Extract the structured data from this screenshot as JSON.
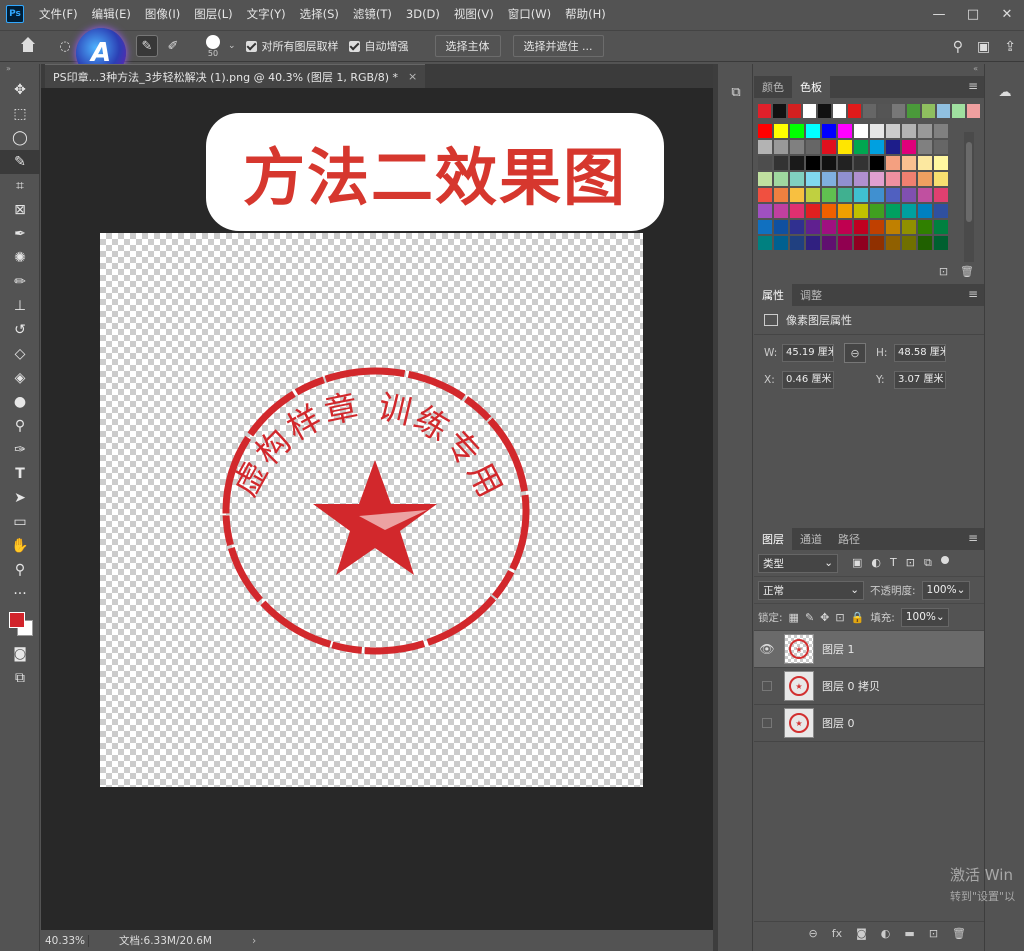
{
  "menubar": {
    "logo": "Ps",
    "items": [
      "文件(F)",
      "编辑(E)",
      "图像(I)",
      "图层(L)",
      "文字(Y)",
      "选择(S)",
      "滤镜(T)",
      "3D(D)",
      "视图(V)",
      "窗口(W)",
      "帮助(H)"
    ],
    "win_min": "—",
    "win_max": "□",
    "win_close": "✕"
  },
  "options": {
    "brush_size": "50",
    "sample_all_label": "对所有图层取样",
    "auto_enhance_label": "自动增强",
    "select_subject": "选择主体",
    "select_mask": "选择并遮住 ..."
  },
  "badge": {
    "letter": "A"
  },
  "document": {
    "tab_title": "PS印章...3种方法_3步轻松解决 (1).png @ 40.3% (图层 1, RGB/8) *",
    "tab_close": "×",
    "headline": "方法二效果图",
    "seal_text": "虚构样章 训练专用"
  },
  "status": {
    "zoom": "40.33%",
    "doc_info": "文档:6.33M/20.6M",
    "arrow": "›"
  },
  "colors_panel": {
    "tab_color": "颜色",
    "tab_swatches": "色板",
    "recent": [
      "#e0202a",
      "#111111",
      "#d32020",
      "#ffffff",
      "#111111",
      "#ffffff",
      "#e01a1a",
      "#666666",
      "#555555",
      "#777777",
      "#4a9a3a",
      "#8fbf5f",
      "#90c0e0",
      "#a0e0a0",
      "#f0a0a0"
    ],
    "grid": [
      [
        "#ff0000",
        "#ffff00",
        "#00ff00",
        "#00ffff",
        "#0000ff",
        "#ff00ff",
        "#ffffff",
        "#e6e6e6",
        "#cccccc",
        "#b3b3b3",
        "#999999",
        "#808080"
      ],
      [
        "#b3b3b3",
        "#999999",
        "#808080",
        "#666666",
        "#e0101e",
        "#ffe600",
        "#00a650",
        "#00a0e0",
        "#1d1d8a",
        "#e0007a",
        "#808080",
        "#666666"
      ],
      [
        "#4d4d4d",
        "#333333",
        "#1a1a1a",
        "#000000",
        "#111111",
        "#222222",
        "#333333",
        "#000000",
        "#f4a080",
        "#f8c090",
        "#fce8a0",
        "#fff7a0"
      ],
      [
        "#c0e0a0",
        "#a0d8a0",
        "#80d0c0",
        "#80d8f0",
        "#80b0e0",
        "#9090d0",
        "#b090d0",
        "#e0a0d0",
        "#f090a0",
        "#f08070",
        "#f0a060",
        "#f8e070"
      ],
      [
        "#f05040",
        "#f08040",
        "#f8c040",
        "#c0d040",
        "#60c050",
        "#40b090",
        "#40c0d0",
        "#4090d0",
        "#5060c0",
        "#8050b0",
        "#c050a0",
        "#e04070"
      ],
      [
        "#a050c0",
        "#c040a0",
        "#e03070",
        "#e02020",
        "#f06000",
        "#f0a000",
        "#c0c000",
        "#40a020",
        "#00a060",
        "#00a0a0",
        "#0080c0",
        "#3050a0"
      ],
      [
        "#1070c0",
        "#1050a0",
        "#303090",
        "#602090",
        "#a01080",
        "#c00050",
        "#c00020",
        "#c04000",
        "#c08000",
        "#909000",
        "#308000",
        "#008040"
      ],
      [
        "#008080",
        "#006090",
        "#204080",
        "#302080",
        "#601070",
        "#900050",
        "#900020",
        "#903000",
        "#906000",
        "#707000",
        "#206000",
        "#006030"
      ]
    ]
  },
  "properties_panel": {
    "tab_props": "属性",
    "tab_adjust": "调整",
    "title": "像素图层属性",
    "w_label": "W:",
    "w_value": "45.19 厘米",
    "h_label": "H:",
    "h_value": "48.58 厘米",
    "x_label": "X:",
    "x_value": "0.46 厘米",
    "y_label": "Y:",
    "y_value": "3.07 厘米",
    "link_glyph": "⊖"
  },
  "layers_panel": {
    "tab_layers": "图层",
    "tab_channels": "通道",
    "tab_paths": "路径",
    "filter_label": "类型",
    "blend_mode": "正常",
    "opacity_label": "不透明度:",
    "opacity_value": "100%",
    "lock_label": "锁定:",
    "fill_label": "填充:",
    "fill_value": "100%",
    "layers": [
      {
        "name": "图层 1",
        "visible": true
      },
      {
        "name": "图层 0 拷贝",
        "visible": false
      },
      {
        "name": "图层 0",
        "visible": false
      }
    ]
  },
  "watermark": {
    "line1": "激活 Win",
    "line2": "转到\"设置\"以"
  }
}
